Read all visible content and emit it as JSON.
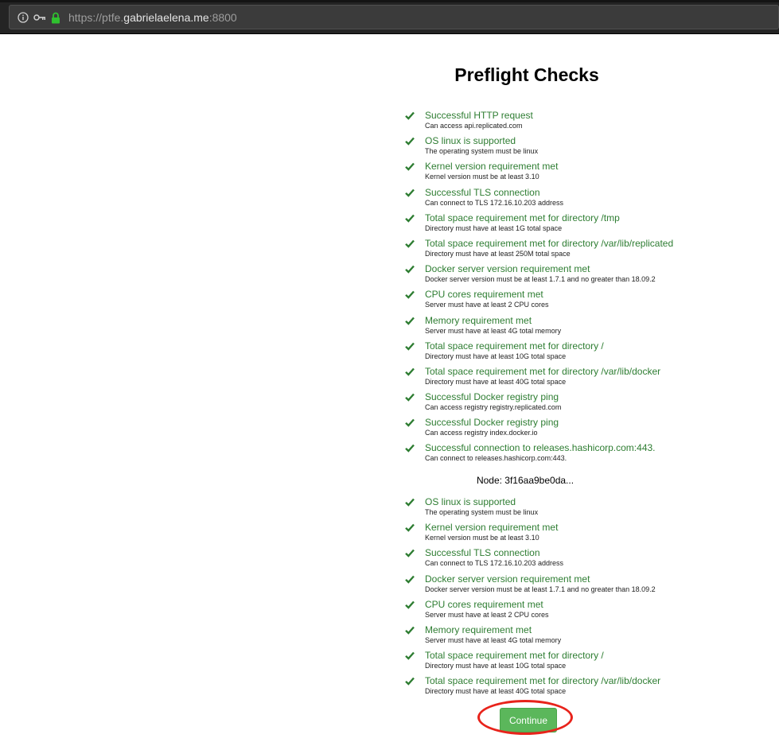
{
  "browser": {
    "url_scheme": "https://",
    "url_subdomain": "ptfe.",
    "url_host": "gabrielaelena.me",
    "url_port": ":8800"
  },
  "page": {
    "title": "Preflight Checks",
    "node_label": "Node: 3f16aa9be0da...",
    "continue_label": "Continue"
  },
  "colors": {
    "success_green": "#2e7d32",
    "button_green": "#5bb75b",
    "highlight_red": "#e8231b"
  },
  "checks": [
    {
      "title": "Successful HTTP request",
      "desc": "Can access api.replicated.com"
    },
    {
      "title": "OS linux is supported",
      "desc": "The operating system must be linux"
    },
    {
      "title": "Kernel version requirement met",
      "desc": "Kernel version must be at least 3.10"
    },
    {
      "title": "Successful TLS connection",
      "desc": "Can connect to TLS 172.16.10.203 address"
    },
    {
      "title": "Total space requirement met for directory /tmp",
      "desc": "Directory must have at least 1G total space"
    },
    {
      "title": "Total space requirement met for directory /var/lib/replicated",
      "desc": "Directory must have at least 250M total space"
    },
    {
      "title": "Docker server version requirement met",
      "desc": "Docker server version must be at least 1.7.1 and no greater than 18.09.2"
    },
    {
      "title": "CPU cores requirement met",
      "desc": "Server must have at least 2 CPU cores"
    },
    {
      "title": "Memory requirement met",
      "desc": "Server must have at least 4G total memory"
    },
    {
      "title": "Total space requirement met for directory /",
      "desc": "Directory must have at least 10G total space"
    },
    {
      "title": "Total space requirement met for directory /var/lib/docker",
      "desc": "Directory must have at least 40G total space"
    },
    {
      "title": "Successful Docker registry ping",
      "desc": "Can access registry registry.replicated.com"
    },
    {
      "title": "Successful Docker registry ping",
      "desc": "Can access registry index.docker.io"
    },
    {
      "title": "Successful connection to releases.hashicorp.com:443.",
      "desc": "Can connect to releases.hashicorp.com:443."
    }
  ],
  "node_checks": [
    {
      "title": "OS linux is supported",
      "desc": "The operating system must be linux"
    },
    {
      "title": "Kernel version requirement met",
      "desc": "Kernel version must be at least 3.10"
    },
    {
      "title": "Successful TLS connection",
      "desc": "Can connect to TLS 172.16.10.203 address"
    },
    {
      "title": "Docker server version requirement met",
      "desc": "Docker server version must be at least 1.7.1 and no greater than 18.09.2"
    },
    {
      "title": "CPU cores requirement met",
      "desc": "Server must have at least 2 CPU cores"
    },
    {
      "title": "Memory requirement met",
      "desc": "Server must have at least 4G total memory"
    },
    {
      "title": "Total space requirement met for directory /",
      "desc": "Directory must have at least 10G total space"
    },
    {
      "title": "Total space requirement met for directory /var/lib/docker",
      "desc": "Directory must have at least 40G total space"
    }
  ]
}
